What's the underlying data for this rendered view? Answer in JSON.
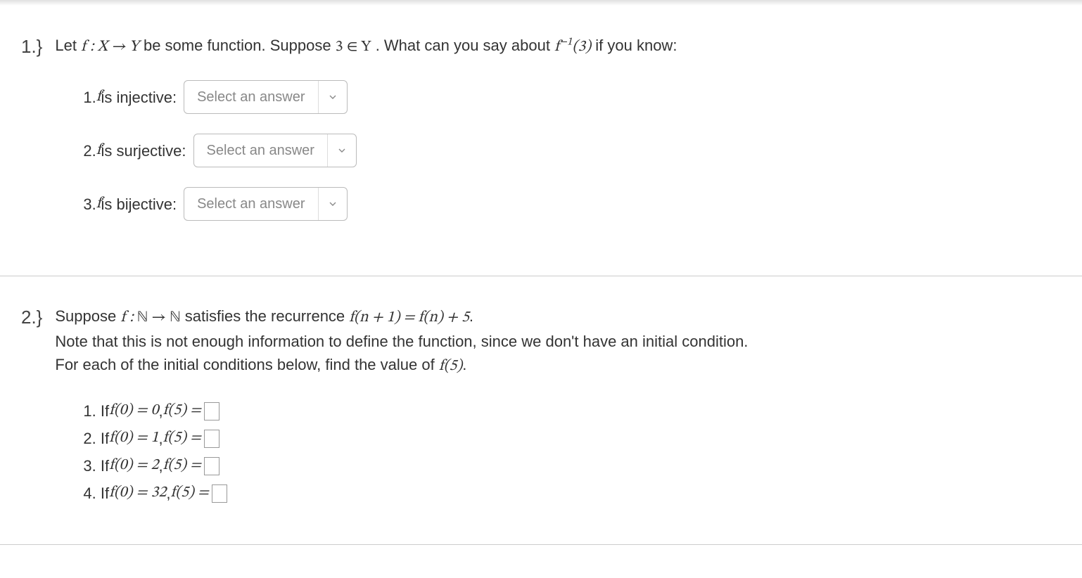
{
  "q1": {
    "number": "1.}",
    "prompt_prefix": "Let ",
    "prompt_f": "f : X → Y",
    "prompt_mid1": " be some function. Suppose ",
    "prompt_3inY": "3 ∈ Y",
    "prompt_mid2": ". What can you say about ",
    "prompt_finv": "f",
    "prompt_finv_sup": "−1",
    "prompt_finv_arg": "(3)",
    "prompt_suffix": " if you know:",
    "parts": {
      "p1_num": "1. ",
      "p1_f": "f",
      "p1_text": " is injective:",
      "p2_num": "2. ",
      "p2_f": "f",
      "p2_text": " is surjective:",
      "p3_num": "3. ",
      "p3_f": "f",
      "p3_text": " is bijective:"
    },
    "select_placeholder": "Select an answer"
  },
  "q2": {
    "number": "2.}",
    "line1_a": "Suppose ",
    "line1_f": "f : ",
    "line1_N1": "ℕ",
    "line1_arrow": " → ",
    "line1_N2": "ℕ",
    "line1_b": " satisfies the recurrence ",
    "line1_rec": "f(n + 1) = f(n) + 5",
    "line1_dot": ".",
    "line2": "Note that this is not enough information to define the function, since we don't have an initial condition.",
    "line3_a": "For each of the initial conditions below, find the value of ",
    "line3_f5": "f(5)",
    "line3_dot": ".",
    "parts": {
      "p1_num": "1. If ",
      "p1_cond": "f(0) = 0",
      "p1_sep": ", ",
      "p1_ask": "f(5) =",
      "p2_num": "2. If ",
      "p2_cond": "f(0) = 1",
      "p2_sep": ", ",
      "p2_ask": "f(5) =",
      "p3_num": "3. If ",
      "p3_cond": "f(0) = 2",
      "p3_sep": ", ",
      "p3_ask": "f(5) =",
      "p4_num": "4. If ",
      "p4_cond": "f(0) = 32",
      "p4_sep": ", ",
      "p4_ask": "f(5) ="
    }
  }
}
